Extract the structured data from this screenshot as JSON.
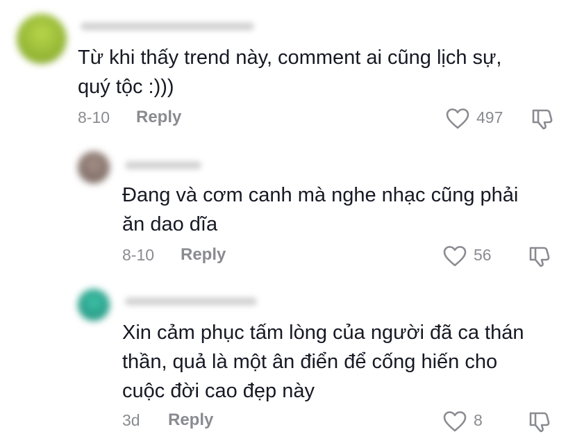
{
  "comments": [
    {
      "text_lines": [
        "Từ khi thấy trend này, comment ai cũng lịch sự,",
        "quý tộc :)))"
      ],
      "date": "8-10",
      "reply_label": "Reply",
      "likes": "497",
      "avatar_color": "#9fc23a"
    },
    {
      "text_lines": [
        "Đang và cơm canh mà nghe nhạc cũng phải",
        "ăn dao dĩa"
      ],
      "date": "8-10",
      "reply_label": "Reply",
      "likes": "56",
      "avatar_color": "#8a7a72"
    },
    {
      "text_lines": [
        "Xin cảm phục tấm lòng của người đã ca thán",
        "thần, quả là một ân điển để cống hiến cho",
        "cuộc đời cao đẹp này"
      ],
      "date": "3d",
      "reply_label": "Reply",
      "likes": "8",
      "avatar_color": "#2fa58f"
    }
  ],
  "icons": {
    "like": "heart-outline-icon",
    "dislike": "thumbs-down-icon"
  }
}
